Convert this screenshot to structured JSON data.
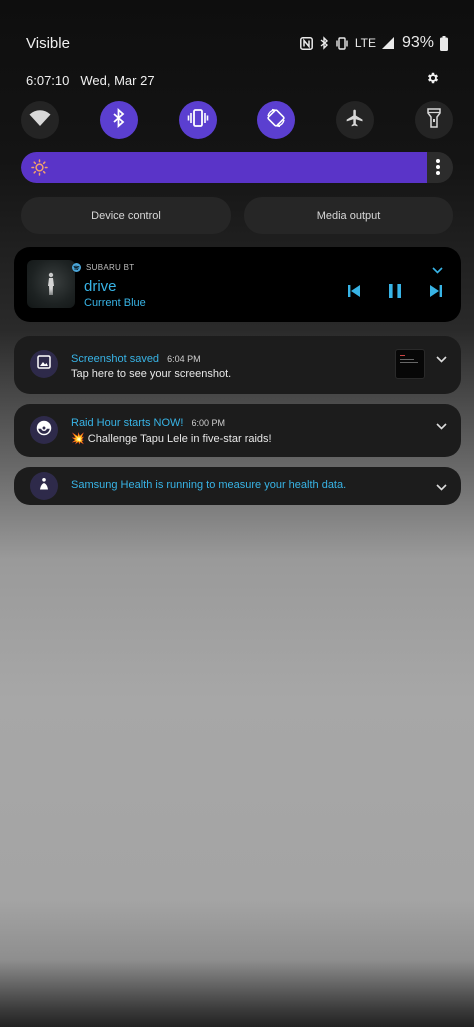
{
  "status_bar": {
    "carrier": "Visible",
    "network": "LTE",
    "battery": "93%",
    "icons": [
      "nfc-icon",
      "bluetooth-icon",
      "vibrate-icon",
      "signal-icon"
    ]
  },
  "header": {
    "time": "6:07:10",
    "date": "Wed, Mar 27",
    "settings_icon": "gear-icon"
  },
  "quick_settings": {
    "tiles": [
      {
        "name": "wifi",
        "icon": "wifi-icon",
        "state": "off"
      },
      {
        "name": "bluetooth",
        "icon": "bluetooth-icon",
        "state": "on"
      },
      {
        "name": "vibrate",
        "icon": "vibrate-icon",
        "state": "on"
      },
      {
        "name": "auto-rotate",
        "icon": "rotate-icon",
        "state": "on"
      },
      {
        "name": "airplane-mode",
        "icon": "airplane-icon",
        "state": "off"
      },
      {
        "name": "flashlight",
        "icon": "flashlight-icon",
        "state": "off"
      }
    ],
    "accent_color": "#5b3fd0"
  },
  "brightness": {
    "level": 0.94
  },
  "controls": {
    "device_control": "Device control",
    "media_output": "Media output"
  },
  "media": {
    "source": "SUBARU BT",
    "title": "drive",
    "artist": "Current Blue",
    "accent_color": "#38b4e6"
  },
  "notifications": [
    {
      "app_icon": "image-icon",
      "title": "Screenshot saved",
      "time": "6:04 PM",
      "text": "Tap here to see your screenshot."
    },
    {
      "app_icon": "pokeball-icon",
      "title": "Raid Hour starts NOW!",
      "time": "6:00 PM",
      "text": "💥 Challenge Tapu Lele in five-star raids!"
    },
    {
      "app_icon": "health-icon",
      "title": "Samsung Health is running to measure your health data."
    }
  ]
}
